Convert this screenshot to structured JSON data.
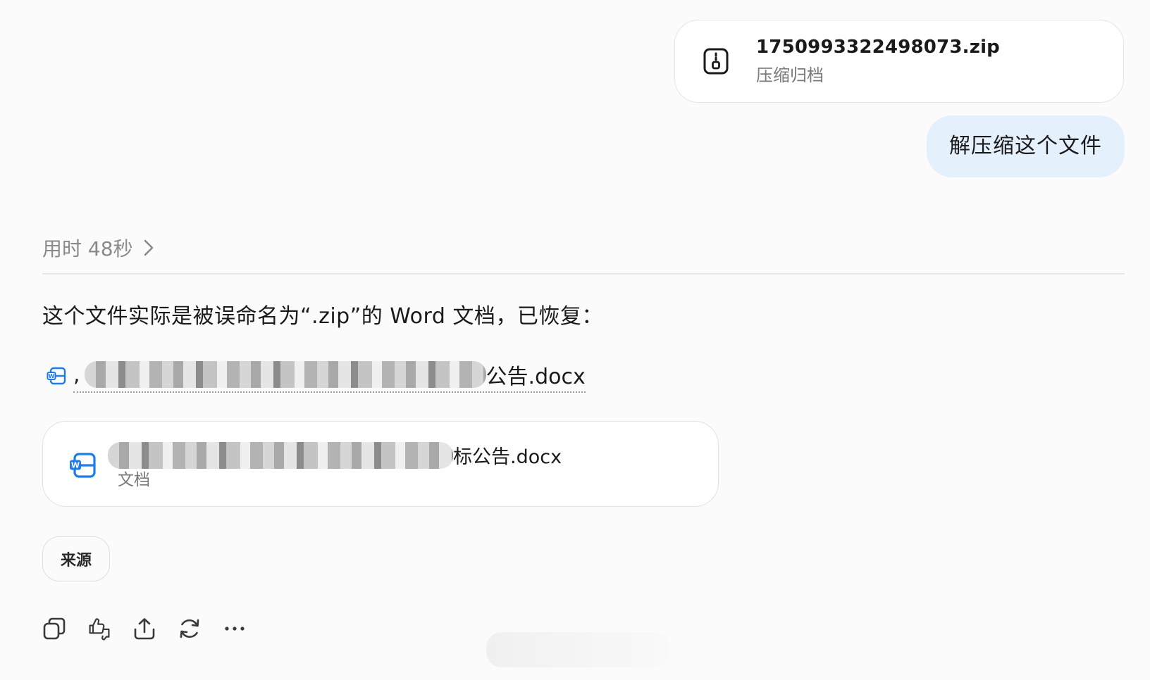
{
  "user": {
    "attachment": {
      "file_name": "1750993322498073.zip",
      "file_type": "压缩归档",
      "icon": "zip-archive-icon"
    },
    "message": "解压缩这个文件"
  },
  "assistant": {
    "thinking_label": "用时 48秒",
    "answer_text": "这个文件实际是被误命名为“.zip”的 Word 文档，已恢复：",
    "link": {
      "prefix": ",",
      "suffix": "公告.docx",
      "icon": "word-doc-icon"
    },
    "doc_card": {
      "name_suffix": "标公告.docx",
      "type": "文档",
      "icon": "word-doc-icon"
    },
    "source_button": "来源"
  },
  "actions": [
    "copy-icon",
    "thumbs-icon",
    "share-icon",
    "regenerate-icon",
    "more-icon"
  ],
  "colors": {
    "accent_blue": "#1e7ce8",
    "user_bubble": "#e4f0fc",
    "background": "#fbfbfb"
  }
}
